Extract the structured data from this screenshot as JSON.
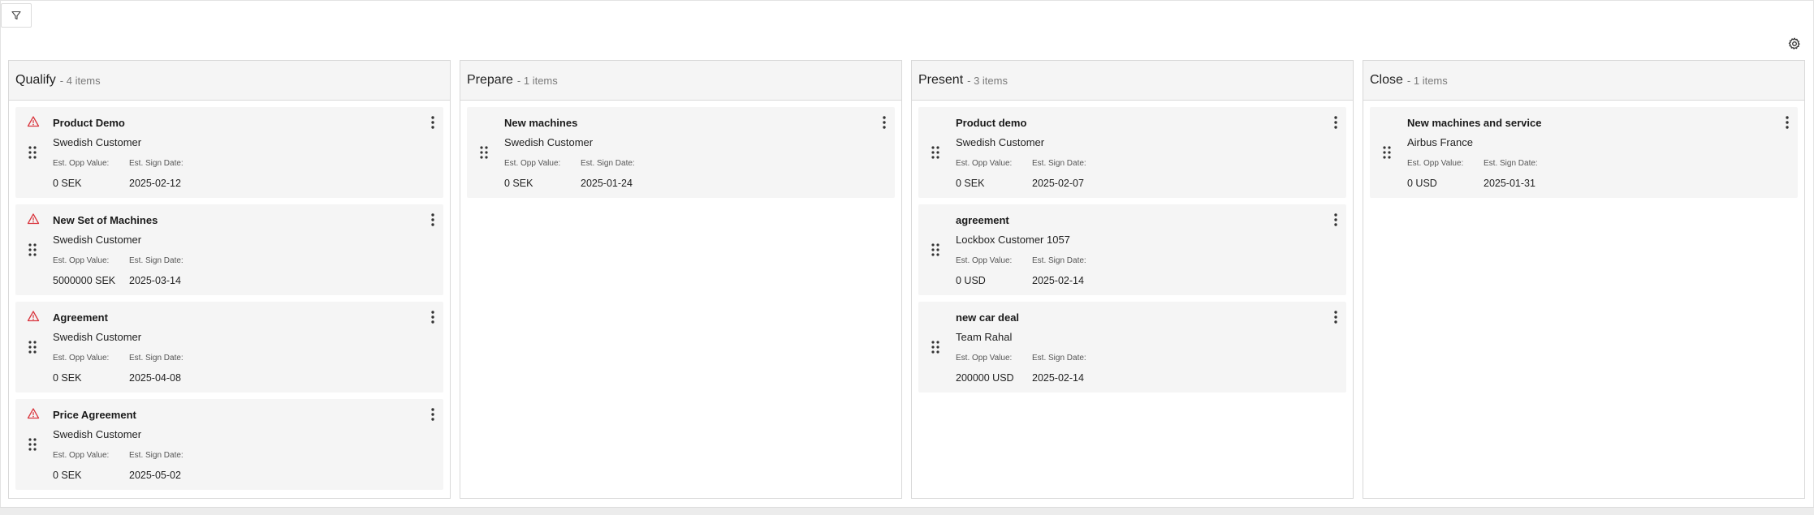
{
  "toolbar": {
    "filter_icon": "filter-icon",
    "settings_icon": "gear-icon"
  },
  "colors": {
    "warning": "#d9363e",
    "card_bg": "#f5f5f5",
    "header_bg": "#f5f5f5",
    "border": "#d9d9d9"
  },
  "labels": {
    "opp_value": "Est. Opp Value:",
    "sign_date": "Est. Sign Date:"
  },
  "columns": [
    {
      "title": "Qualify",
      "count": "- 4 items",
      "cards": [
        {
          "title": "Product Demo",
          "customer": "Swedish Customer",
          "value": "0 SEK",
          "date": "2025-02-12",
          "warning": true
        },
        {
          "title": "New Set of Machines",
          "customer": "Swedish Customer",
          "value": "5000000 SEK",
          "date": "2025-03-14",
          "warning": true
        },
        {
          "title": "Agreement",
          "customer": "Swedish Customer",
          "value": "0 SEK",
          "date": "2025-04-08",
          "warning": true
        },
        {
          "title": "Price Agreement",
          "customer": "Swedish Customer",
          "value": "0 SEK",
          "date": "2025-05-02",
          "warning": true
        }
      ]
    },
    {
      "title": "Prepare",
      "count": "- 1 items",
      "cards": [
        {
          "title": "New machines",
          "customer": "Swedish Customer",
          "value": "0 SEK",
          "date": "2025-01-24",
          "warning": false
        }
      ]
    },
    {
      "title": "Present",
      "count": "- 3 items",
      "cards": [
        {
          "title": "Product demo",
          "customer": "Swedish Customer",
          "value": "0 SEK",
          "date": "2025-02-07",
          "warning": false
        },
        {
          "title": "agreement",
          "customer": "Lockbox Customer 1057",
          "value": "0 USD",
          "date": "2025-02-14",
          "warning": false
        },
        {
          "title": "new car deal",
          "customer": "Team Rahal",
          "value": "200000 USD",
          "date": "2025-02-14",
          "warning": false
        }
      ]
    },
    {
      "title": "Close",
      "count": "- 1 items",
      "cards": [
        {
          "title": "New machines and service",
          "customer": "Airbus France",
          "value": "0 USD",
          "date": "2025-01-31",
          "warning": false
        }
      ]
    }
  ]
}
